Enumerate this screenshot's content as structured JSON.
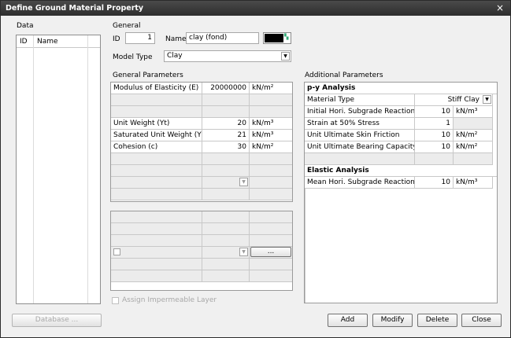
{
  "window": {
    "title": "Define Ground Material Property",
    "close_glyph": "×"
  },
  "data_panel": {
    "label": "Data",
    "col_id": "ID",
    "col_name": "Name"
  },
  "general": {
    "label": "General",
    "id_label": "ID",
    "id_value": "1",
    "name_label": "Name",
    "name_value": "clay (fond)",
    "model_type_label": "Model Type",
    "model_type_value": "Clay",
    "color_swatch": "#000000"
  },
  "general_parameters": {
    "label": "General Parameters",
    "rows": [
      {
        "name": "Modulus of Elasticity (E)",
        "value": "20000000",
        "unit": "kN/m²"
      },
      {
        "name": "",
        "value": "",
        "unit": ""
      },
      {
        "name": "",
        "value": "",
        "unit": ""
      },
      {
        "name": "Unit Weight (Yt)",
        "value": "20",
        "unit": "kN/m³"
      },
      {
        "name": "Saturated Unit Weight (Ysat)",
        "value": "21",
        "unit": "kN/m³"
      },
      {
        "name": "Cohesion (c)",
        "value": "30",
        "unit": "kN/m²"
      }
    ],
    "more_button": "...",
    "assign_impermeable": "Assign Impermeable Layer"
  },
  "additional_parameters": {
    "label": "Additional Parameters",
    "py_header": "p-y Analysis",
    "py_rows": [
      {
        "name": "Material Type",
        "value": "Stiff Clay",
        "unit": ""
      },
      {
        "name": "Initial Hori. Subgrade Reaction (Kh)",
        "value": "10",
        "unit": "kN/m³"
      },
      {
        "name": "Strain at 50% Stress",
        "value": "1",
        "unit": ""
      },
      {
        "name": "Unit Ultimate Skin Friction",
        "value": "10",
        "unit": "kN/m²"
      },
      {
        "name": "Unit Ultimate Bearing Capacity",
        "value": "10",
        "unit": "kN/m²"
      }
    ],
    "elastic_header": "Elastic Analysis",
    "elastic_rows": [
      {
        "name": "Mean Hori. Subgrade Reaction (Kh)",
        "value": "10",
        "unit": "kN/m³"
      }
    ]
  },
  "buttons": {
    "database": "Database ...",
    "add": "Add",
    "modify": "Modify",
    "delete": "Delete",
    "close": "Close"
  }
}
